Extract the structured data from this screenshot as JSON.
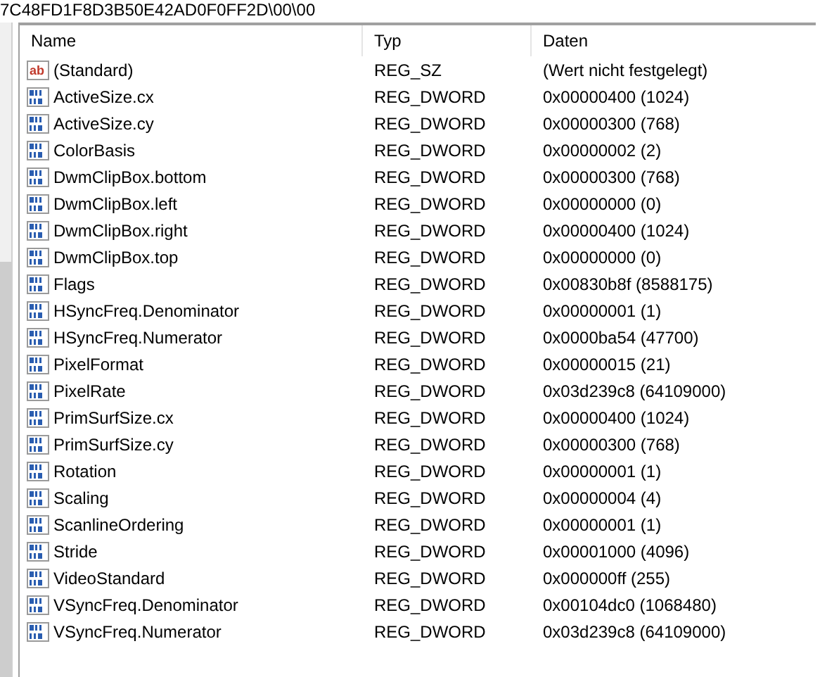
{
  "path": "7C48FD1F8D3B50E42AD0F0FF2D\\00\\00",
  "columns": [
    "Name",
    "Typ",
    "Daten"
  ],
  "rows": [
    {
      "kind": "string",
      "icon_label": "ab",
      "name": "(Standard)",
      "type": "REG_SZ",
      "data": "(Wert nicht festgelegt)"
    },
    {
      "kind": "binary",
      "name": "ActiveSize.cx",
      "type": "REG_DWORD",
      "data": "0x00000400 (1024)"
    },
    {
      "kind": "binary",
      "name": "ActiveSize.cy",
      "type": "REG_DWORD",
      "data": "0x00000300 (768)"
    },
    {
      "kind": "binary",
      "name": "ColorBasis",
      "type": "REG_DWORD",
      "data": "0x00000002 (2)"
    },
    {
      "kind": "binary",
      "name": "DwmClipBox.bottom",
      "type": "REG_DWORD",
      "data": "0x00000300 (768)"
    },
    {
      "kind": "binary",
      "name": "DwmClipBox.left",
      "type": "REG_DWORD",
      "data": "0x00000000 (0)"
    },
    {
      "kind": "binary",
      "name": "DwmClipBox.right",
      "type": "REG_DWORD",
      "data": "0x00000400 (1024)"
    },
    {
      "kind": "binary",
      "name": "DwmClipBox.top",
      "type": "REG_DWORD",
      "data": "0x00000000 (0)"
    },
    {
      "kind": "binary",
      "name": "Flags",
      "type": "REG_DWORD",
      "data": "0x00830b8f (8588175)"
    },
    {
      "kind": "binary",
      "name": "HSyncFreq.Denominator",
      "type": "REG_DWORD",
      "data": "0x00000001 (1)"
    },
    {
      "kind": "binary",
      "name": "HSyncFreq.Numerator",
      "type": "REG_DWORD",
      "data": "0x0000ba54 (47700)"
    },
    {
      "kind": "binary",
      "name": "PixelFormat",
      "type": "REG_DWORD",
      "data": "0x00000015 (21)"
    },
    {
      "kind": "binary",
      "name": "PixelRate",
      "type": "REG_DWORD",
      "data": "0x03d239c8 (64109000)"
    },
    {
      "kind": "binary",
      "name": "PrimSurfSize.cx",
      "type": "REG_DWORD",
      "data": "0x00000400 (1024)"
    },
    {
      "kind": "binary",
      "name": "PrimSurfSize.cy",
      "type": "REG_DWORD",
      "data": "0x00000300 (768)"
    },
    {
      "kind": "binary",
      "name": "Rotation",
      "type": "REG_DWORD",
      "data": "0x00000001 (1)"
    },
    {
      "kind": "binary",
      "name": "Scaling",
      "type": "REG_DWORD",
      "data": "0x00000004 (4)"
    },
    {
      "kind": "binary",
      "name": "ScanlineOrdering",
      "type": "REG_DWORD",
      "data": "0x00000001 (1)"
    },
    {
      "kind": "binary",
      "name": "Stride",
      "type": "REG_DWORD",
      "data": "0x00001000 (4096)"
    },
    {
      "kind": "binary",
      "name": "VideoStandard",
      "type": "REG_DWORD",
      "data": "0x000000ff (255)"
    },
    {
      "kind": "binary",
      "name": "VSyncFreq.Denominator",
      "type": "REG_DWORD",
      "data": "0x00104dc0 (1068480)"
    },
    {
      "kind": "binary",
      "name": "VSyncFreq.Numerator",
      "type": "REG_DWORD",
      "data": "0x03d239c8 (64109000)"
    }
  ]
}
